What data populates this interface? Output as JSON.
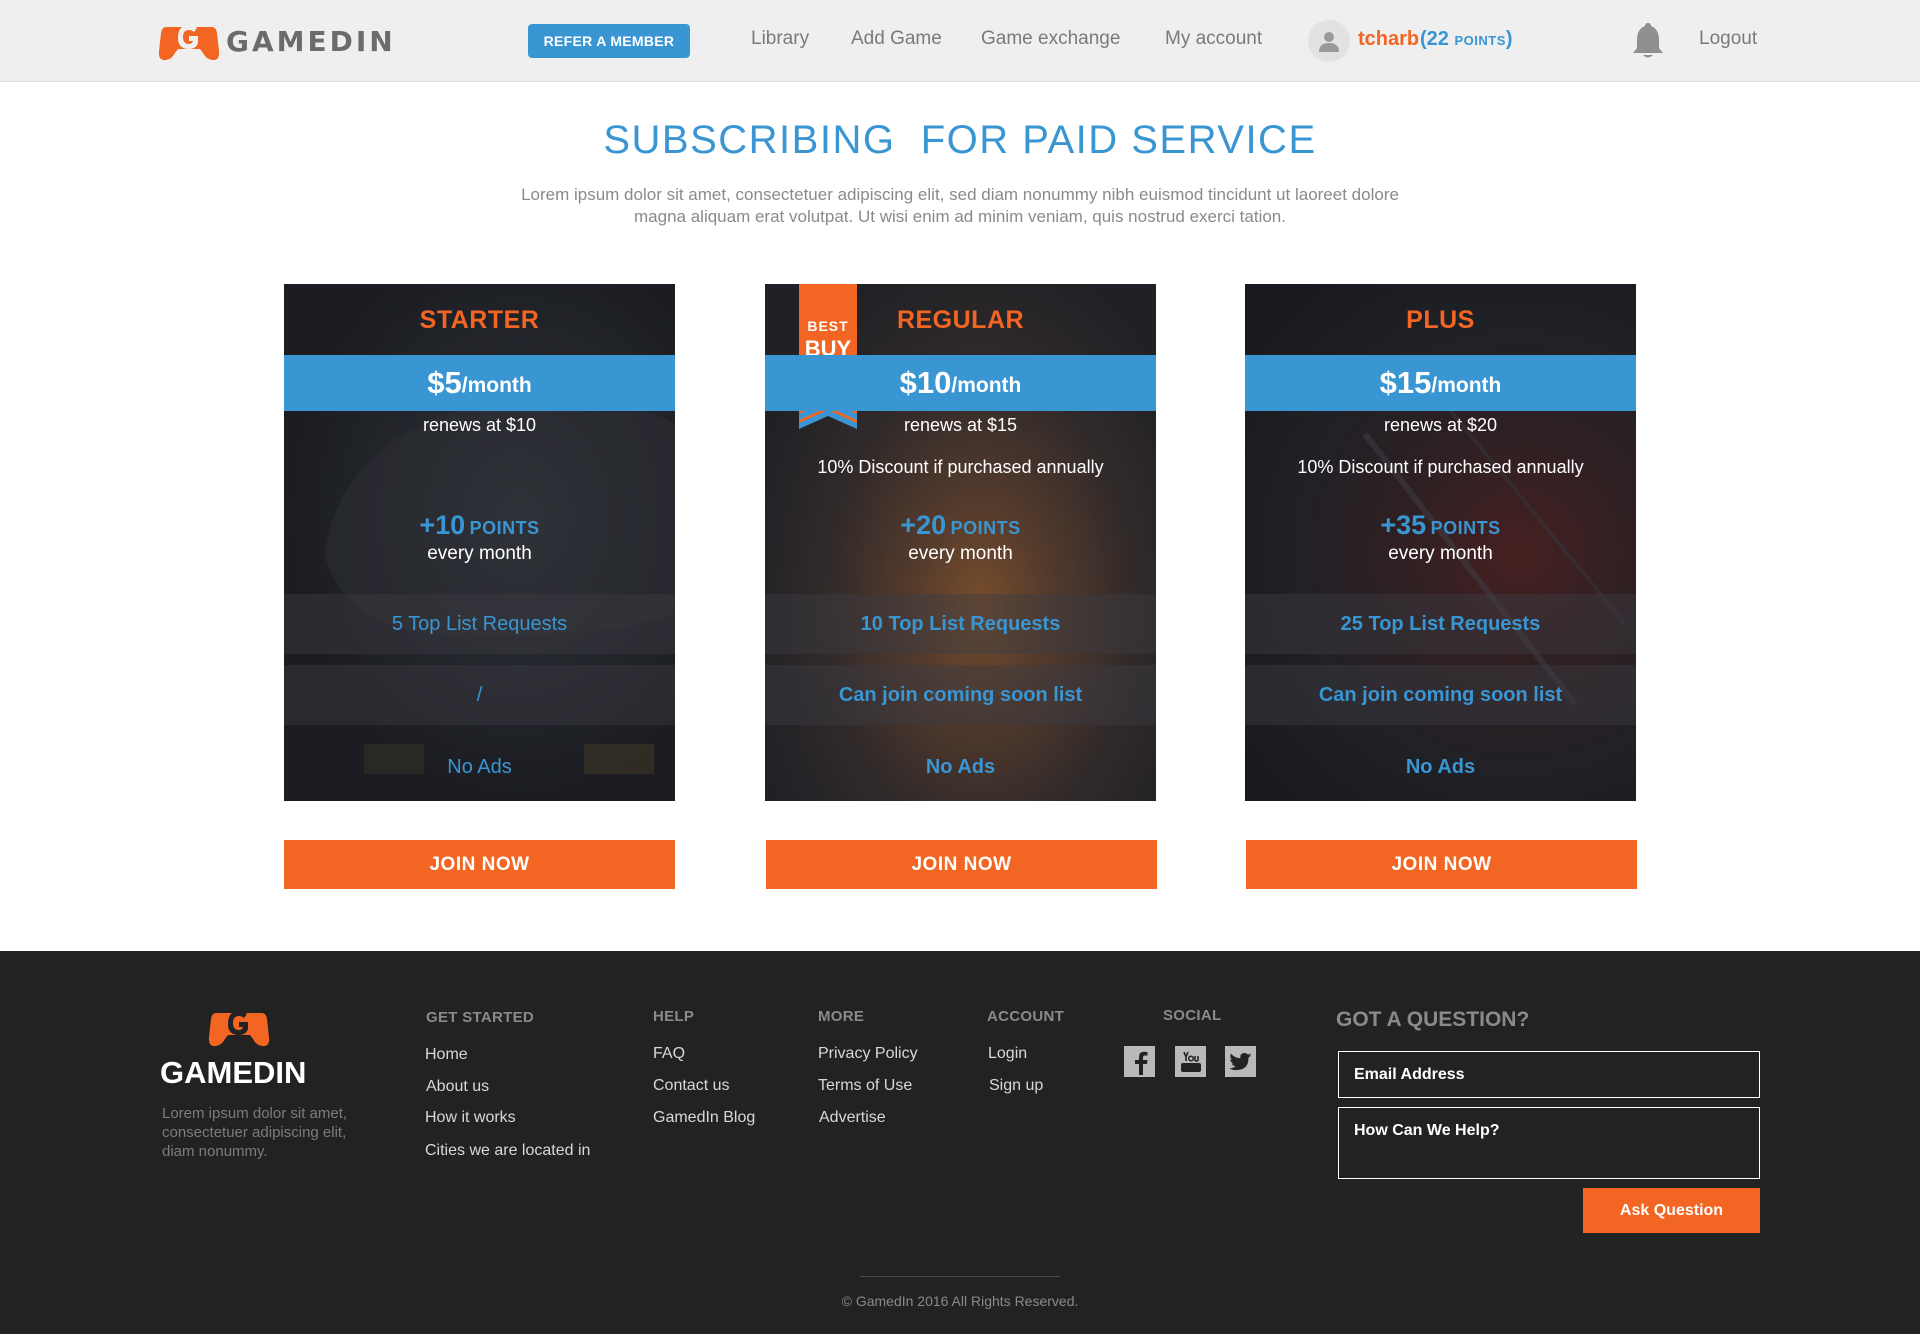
{
  "header": {
    "logo_text": "GAMEDIN",
    "refer_label": "REFER A MEMBER",
    "nav": [
      "Library",
      "Add Game",
      "Game exchange",
      "My account"
    ],
    "user": {
      "name": "tcharb",
      "points_open": "(22 ",
      "points_unit": "POINTS",
      "points_close": ")"
    },
    "logout_label": "Logout"
  },
  "hero": {
    "title": "SUBSCRIBING  FOR PAID SERVICE",
    "description": "Lorem ipsum dolor sit amet, consectetuer adipiscing elit, sed diam nonummy nibh euismod tincidunt ut laoreet dolore magna aliquam erat volutpat. Ut wisi enim ad minim veniam, quis nostrud exerci tation."
  },
  "plans": [
    {
      "name": "STARTER",
      "price": "$5",
      "per": "/month",
      "renew": "renews at $10",
      "discount": "",
      "points_num": "+10",
      "points_lbl": "POINTS",
      "every": "every month",
      "features": [
        "5 Top List Requests",
        "/",
        "No Ads"
      ],
      "join_label": "JOIN NOW"
    },
    {
      "name": "REGULAR",
      "price": "$10",
      "per": "/month",
      "renew": "renews at $15",
      "discount": "10% Discount if purchased annually",
      "points_num": "+20",
      "points_lbl": "POINTS",
      "every": "every month",
      "features": [
        "10 Top List Requests",
        "Can join coming soon list",
        "No Ads"
      ],
      "join_label": "JOIN NOW",
      "ribbon_top": "BEST",
      "ribbon_bottom": "BUY"
    },
    {
      "name": "PLUS",
      "price": "$15",
      "per": "/month",
      "renew": "renews at $20",
      "discount": "10% Discount if purchased annually",
      "points_num": "+35",
      "points_lbl": "POINTS",
      "every": "every month",
      "features": [
        "25 Top List Requests",
        "Can join coming soon list",
        "No Ads"
      ],
      "join_label": "JOIN NOW"
    }
  ],
  "footer": {
    "logo_text": "GAMEDIN",
    "about": "Lorem ipsum dolor sit amet, consectetuer adipiscing elit, diam nonummy.",
    "columns": [
      {
        "title": "GET STARTED",
        "links": [
          "Home",
          "About us",
          "How it works",
          "Cities we are located in"
        ]
      },
      {
        "title": "HELP",
        "links": [
          "FAQ",
          "Contact us",
          "GamedIn Blog"
        ]
      },
      {
        "title": "MORE",
        "links": [
          "Privacy Policy",
          "Terms of Use",
          "Advertise"
        ]
      },
      {
        "title": "ACCOUNT",
        "links": [
          "Login",
          "Sign up"
        ]
      },
      {
        "title": "SOCIAL",
        "links": []
      }
    ],
    "social_icons": [
      "facebook-icon",
      "youtube-icon",
      "twitter-icon"
    ],
    "question": {
      "title": "GOT A QUESTION?",
      "email_placeholder": "Email Address",
      "help_placeholder": "How Can We Help?",
      "ask_label": "Ask Question"
    },
    "copyright": "© GamedIn 2016 All Rights Reserved."
  },
  "colors": {
    "brand_orange": "#f26522",
    "brand_blue": "#3a96d3",
    "footer_bg": "#222222"
  }
}
